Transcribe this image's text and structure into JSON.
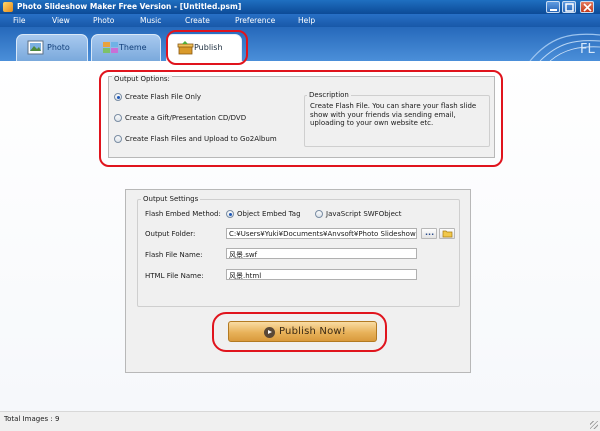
{
  "window": {
    "title": "Photo Slideshow Maker Free Version - [Untitled.psm]"
  },
  "menu": [
    "File",
    "View",
    "Photo",
    "Music",
    "Create",
    "Preference",
    "Help"
  ],
  "tabs": [
    {
      "label": "Photo",
      "icon": "photo-icon"
    },
    {
      "label": "Theme",
      "icon": "theme-icon"
    },
    {
      "label": "Publish",
      "icon": "publish-icon",
      "active": true
    }
  ],
  "output_options": {
    "title": "Output Options:",
    "options": [
      {
        "label": "Create Flash File Only",
        "selected": true
      },
      {
        "label": "Create a Gift/Presentation CD/DVD",
        "selected": false
      },
      {
        "label": "Create Flash Files and Upload to Go2Album",
        "selected": false
      }
    ],
    "description_title": "Description",
    "description_text": "Create Flash File. You can share your flash slide show with your friends via sending email, uploading to your own website etc."
  },
  "output_settings": {
    "title": "Output Settings",
    "embed_label": "Flash Embed Method:",
    "embed_options": [
      {
        "label": "Object Embed Tag",
        "selected": true
      },
      {
        "label": "JavaScript SWFObject",
        "selected": false
      }
    ],
    "folder_label": "Output Folder:",
    "folder_value": "C:¥Users¥Yuki¥Documents¥Anvsoft¥Photo Slideshow Maker Free",
    "browse_label": "...",
    "flash_name_label": "Flash File Name:",
    "flash_name_value": "风景.swf",
    "html_name_label": "HTML File Name:",
    "html_name_value": "风景.html"
  },
  "publish_button": "Publish Now!",
  "status": "Total Images : 9",
  "colors": {
    "highlight": "#e0141d",
    "titlebar": "#0c4a97",
    "button": "#e8b25a"
  }
}
